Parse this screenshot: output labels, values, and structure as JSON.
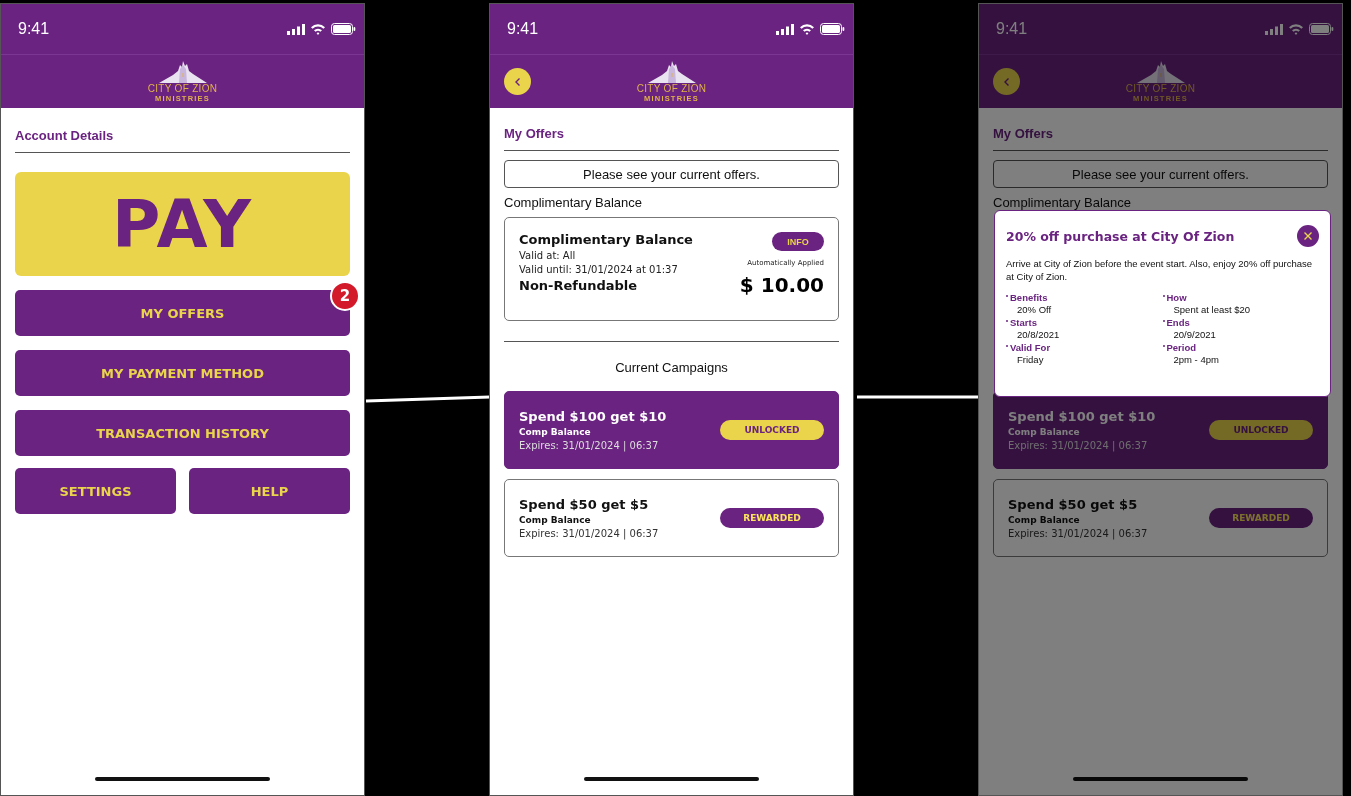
{
  "screens": [
    {
      "kind": "home",
      "status_time": "9:41",
      "logo": {
        "name": "CITY OF ZION",
        "sub": "MINISTRIES"
      },
      "title": "Account Details",
      "pay_label": "PAY",
      "menu": [
        {
          "label": "MY OFFERS",
          "badge": "2"
        },
        {
          "label": "MY PAYMENT METHOD"
        },
        {
          "label": "TRANSACTION HISTORY"
        }
      ],
      "bottom_buttons": [
        "SETTINGS",
        "HELP"
      ]
    },
    {
      "kind": "offers",
      "status_time": "9:41",
      "logo": {
        "name": "CITY OF ZION",
        "sub": "MINISTRIES"
      },
      "title": "My Offers",
      "notice": "Please see your current offers.",
      "section_label": "Complimentary Balance",
      "balance_card": {
        "title": "Complimentary Balance",
        "valid_at": "Valid at: All",
        "valid_until": "Valid until: 31/01/2024 at 01:37",
        "refund": "Non-Refundable",
        "button": "INFO",
        "note": "Automatically Applied",
        "amount": "$ 10.00"
      },
      "campaigns_heading": "Current Campaigns",
      "campaigns": [
        {
          "title": "Spend $100 get $10",
          "subtitle": "Comp Balance",
          "expires": "Expires: 31/01/2024 | 06:37",
          "status": "UNLOCKED",
          "highlighted": true
        },
        {
          "title": "Spend $50 get $5",
          "subtitle": "Comp Balance",
          "expires": "Expires: 31/01/2024 | 06:37",
          "status": "REWARDED",
          "highlighted": false
        }
      ]
    },
    {
      "kind": "offers_popup",
      "status_time": "9:41",
      "logo": {
        "name": "CITY OF ZION",
        "sub": "MINISTRIES"
      },
      "title": "My Offers",
      "notice": "Please see your current offers.",
      "section_label": "Complimentary Balance",
      "campaigns": [
        {
          "title": "Spend $100 get $10",
          "subtitle": "Comp Balance",
          "expires": "Expires: 31/01/2024 | 06:37",
          "status": "UNLOCKED",
          "highlighted": true
        },
        {
          "title": "Spend $50 get $5",
          "subtitle": "Comp Balance",
          "expires": "Expires: 31/01/2024 | 06:37",
          "status": "REWARDED",
          "highlighted": false
        }
      ],
      "popup": {
        "title": "20% off purchase at City Of Zion",
        "text": "Arrive at City of Zion before the event start. Also, enjoy 20% off purchase at City of Zion.",
        "details": [
          {
            "label": "Benefits",
            "value": "20% Off"
          },
          {
            "label": "How",
            "value": "Spent at least $20"
          },
          {
            "label": "Starts",
            "value": "20/8/2021"
          },
          {
            "label": "Ends",
            "value": "20/9/2021"
          },
          {
            "label": "Valid For",
            "value": "Friday"
          },
          {
            "label": "Period",
            "value": "2pm - 4pm"
          }
        ]
      }
    }
  ]
}
